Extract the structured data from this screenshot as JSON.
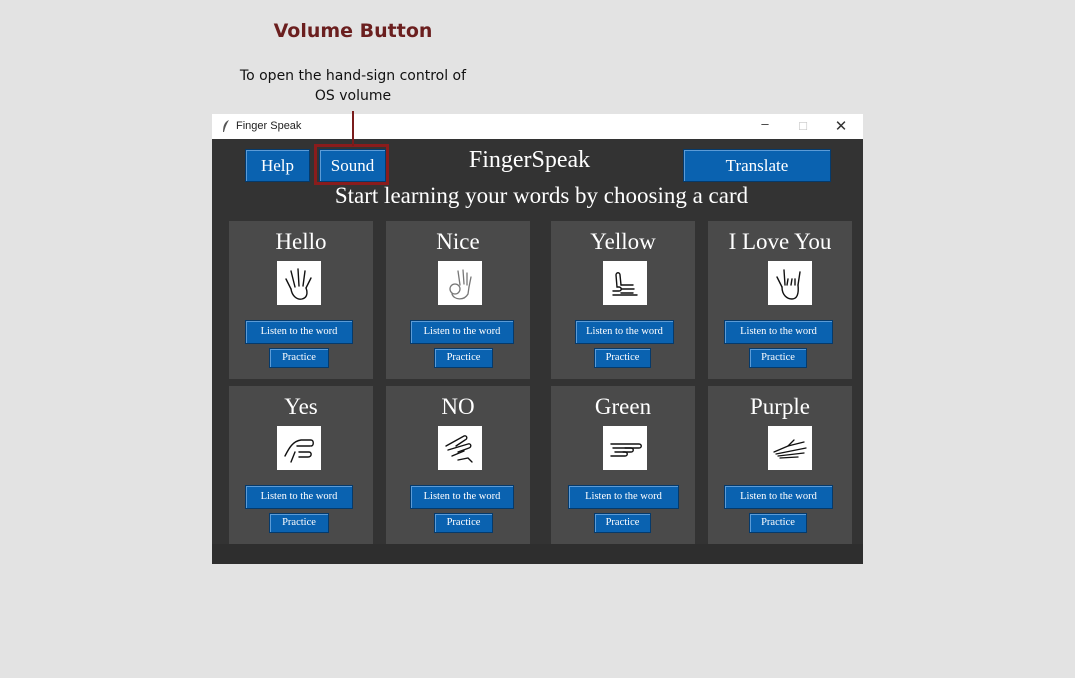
{
  "annotation": {
    "title": "Volume Button",
    "description": "To open the hand-sign control of OS volume"
  },
  "window": {
    "title": "Finger Speak",
    "minimize": "–",
    "maximize": "□",
    "close": "✕"
  },
  "toolbar": {
    "help_label": "Help",
    "sound_label": "Sound",
    "translate_label": "Translate"
  },
  "app_title": "FingerSpeak",
  "subtitle": "Start learning your words by choosing a card",
  "cards": [
    {
      "word": "Hello",
      "icon": "open-hand-icon",
      "listen_label": "Listen to the word",
      "practice_label": "Practice"
    },
    {
      "word": "Nice",
      "icon": "ok-hand-icon",
      "listen_label": "Listen to the word",
      "practice_label": "Practice"
    },
    {
      "word": "Yellow",
      "icon": "thumb-side-icon",
      "listen_label": "Listen to the word",
      "practice_label": "Practice"
    },
    {
      "word": "I Love You",
      "icon": "ily-hand-icon",
      "listen_label": "Listen to the word",
      "practice_label": "Practice"
    },
    {
      "word": "Yes",
      "icon": "fist-icon",
      "listen_label": "Listen to the word",
      "practice_label": "Practice"
    },
    {
      "word": "NO",
      "icon": "pinch-hand-icon",
      "listen_label": "Listen to the word",
      "practice_label": "Practice"
    },
    {
      "word": "Green",
      "icon": "point-side-icon",
      "listen_label": "Listen to the word",
      "practice_label": "Practice"
    },
    {
      "word": "Purple",
      "icon": "flat-hand-side-icon",
      "listen_label": "Listen to the word",
      "practice_label": "Practice"
    }
  ],
  "colors": {
    "accent_button": "#0a62b0",
    "window_bg": "#333333",
    "card_bg": "#4a4a4a",
    "annotation": "#6b1f1f"
  }
}
